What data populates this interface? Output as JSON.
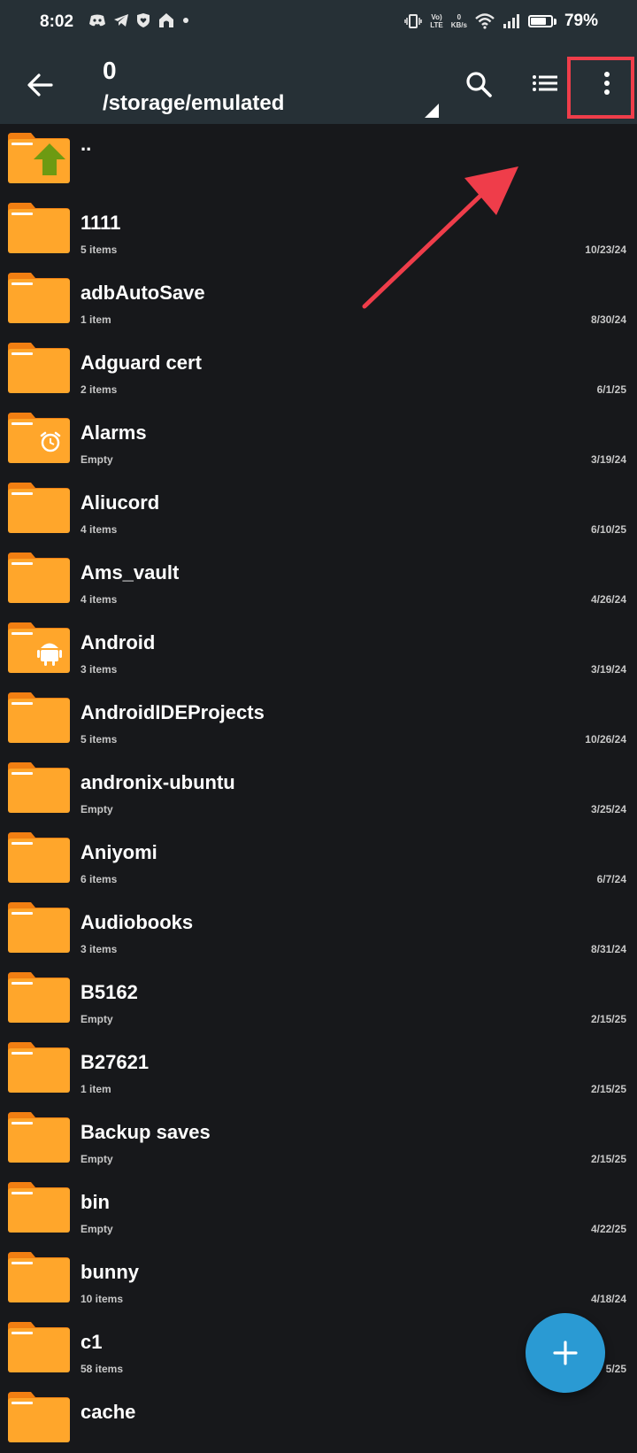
{
  "status_bar": {
    "time": "8:02",
    "notification_icons": [
      "discord-icon",
      "telegram-icon",
      "shield-heart-icon",
      "home-icon",
      "dot-icon"
    ],
    "volte_top": "Vo)",
    "volte_bottom": "LTE",
    "speed_top": "0",
    "speed_bottom": "KB/s",
    "battery_percent": "79%",
    "battery_level": 0.79
  },
  "toolbar": {
    "title": "0",
    "path": "/storage/emulated"
  },
  "files": [
    {
      "name": "..",
      "kind": "parent"
    },
    {
      "name": "1111",
      "count": "5 items",
      "date": "10/23/24"
    },
    {
      "name": "adbAutoSave",
      "count": "1 item",
      "date": "8/30/24"
    },
    {
      "name": "Adguard cert",
      "count": "2 items",
      "date": "6/1/25"
    },
    {
      "name": "Alarms",
      "count": "Empty",
      "date": "3/19/24",
      "badge": "alarm-icon"
    },
    {
      "name": "Aliucord",
      "count": "4 items",
      "date": "6/10/25"
    },
    {
      "name": "Ams_vault",
      "count": "4 items",
      "date": "4/26/24"
    },
    {
      "name": "Android",
      "count": "3 items",
      "date": "3/19/24",
      "badge": "android-icon"
    },
    {
      "name": "AndroidIDEProjects",
      "count": "5 items",
      "date": "10/26/24"
    },
    {
      "name": "andronix-ubuntu",
      "count": "Empty",
      "date": "3/25/24"
    },
    {
      "name": "Aniyomi",
      "count": "6 items",
      "date": "6/7/24"
    },
    {
      "name": "Audiobooks",
      "count": "3 items",
      "date": "8/31/24"
    },
    {
      "name": "B5162",
      "count": "Empty",
      "date": "2/15/25"
    },
    {
      "name": "B27621",
      "count": "1 item",
      "date": "2/15/25"
    },
    {
      "name": "Backup saves",
      "count": "Empty",
      "date": "2/15/25"
    },
    {
      "name": "bin",
      "count": "Empty",
      "date": "4/22/25"
    },
    {
      "name": "bunny",
      "count": "10 items",
      "date": "4/18/24"
    },
    {
      "name": "c1",
      "count": "58 items",
      "date": "5/25"
    },
    {
      "name": "cache",
      "count": "",
      "date": ""
    }
  ],
  "colors": {
    "background": "#17181b",
    "toolbar": "#263036",
    "folder_body": "#ffa62b",
    "folder_tab": "#f17f12",
    "fab": "#2a9ad3",
    "annotation": "#ef3d4a"
  }
}
